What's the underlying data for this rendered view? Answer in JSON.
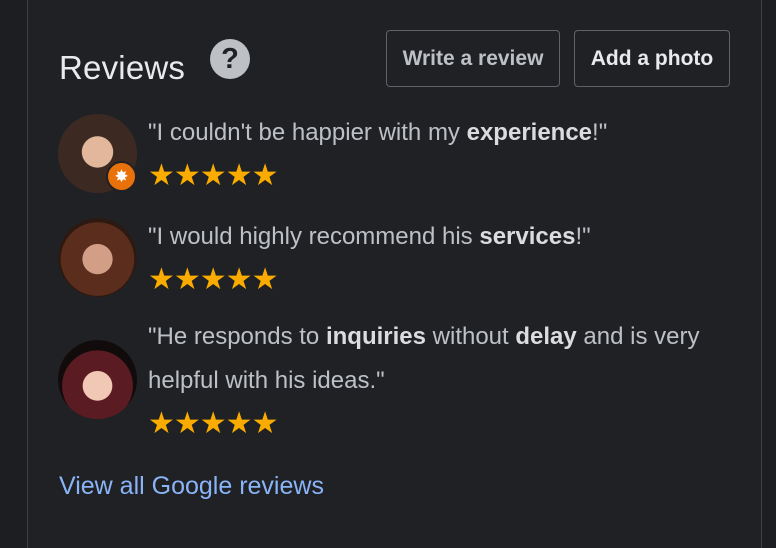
{
  "header": {
    "title": "Reviews",
    "help_icon": "?",
    "write_review_label": "Write a review",
    "add_photo_label": "Add a photo"
  },
  "reviews": [
    {
      "avatar_icon": "reviewer-avatar",
      "badge_icon": "local-guide-badge",
      "badge_glyph": "✸",
      "parts": [
        "\"I couldn't be happier with my ",
        "experience",
        "!\""
      ],
      "stars": "★★★★★",
      "rating": 5
    },
    {
      "avatar_icon": "reviewer-avatar",
      "parts": [
        "\"I would highly recommend his ",
        "services",
        "!\""
      ],
      "stars": "★★★★★",
      "rating": 5
    },
    {
      "avatar_icon": "reviewer-avatar",
      "parts": [
        "\"He responds to ",
        "inquiries",
        " without ",
        "delay",
        " and is very helpful with his ideas.\""
      ],
      "stars": "★★★★★",
      "rating": 5
    }
  ],
  "footer": {
    "view_all_label": "View all Google reviews"
  },
  "colors": {
    "background": "#202124",
    "text": "#bdc1c6",
    "star": "#f9ab00",
    "link": "#8ab4f8",
    "badge": "#e8710a"
  }
}
